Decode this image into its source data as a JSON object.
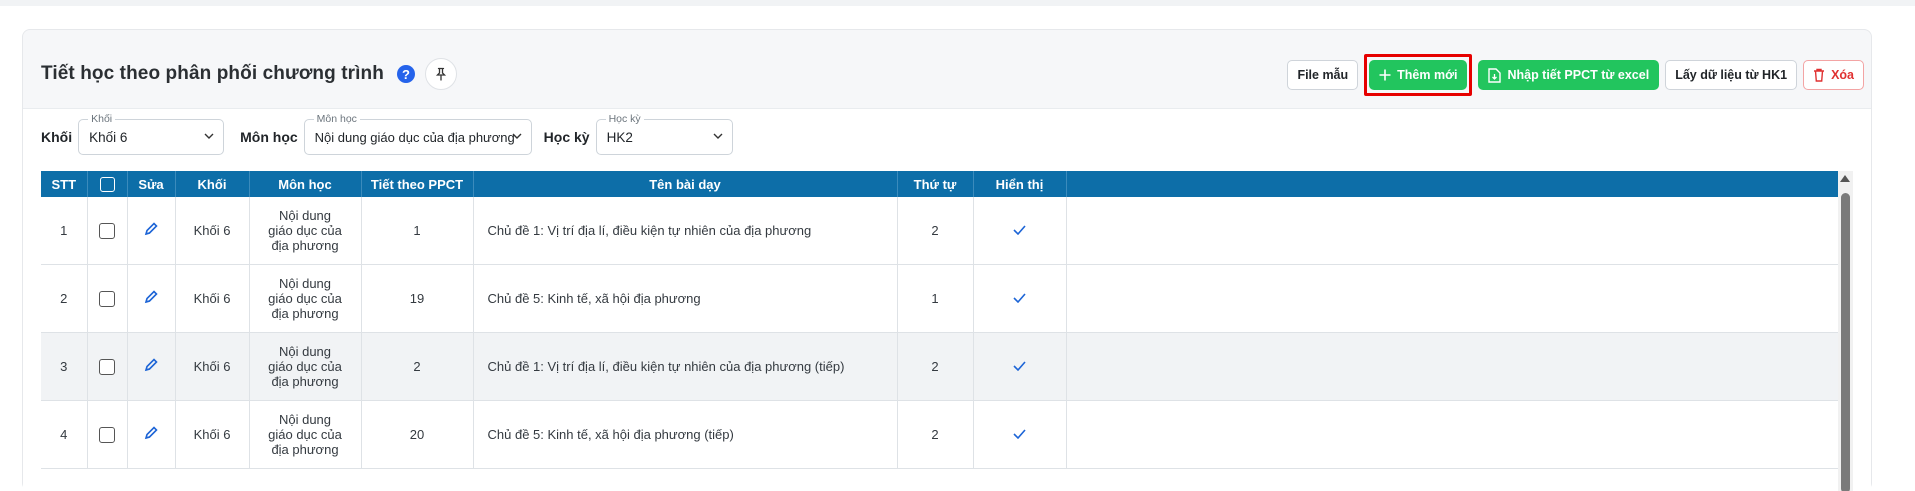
{
  "header": {
    "title": "Tiết học theo phân phối chương trình",
    "help_glyph": "?"
  },
  "toolbar": {
    "sample_file": "File mẫu",
    "add_new": "Thêm mới",
    "import_excel": "Nhập tiết PPCT từ excel",
    "get_hk1": "Lấy dữ liệu từ HK1",
    "delete": "Xóa"
  },
  "filters": {
    "grade": {
      "label": "Khối",
      "legend": "Khối",
      "value": "Khối 6"
    },
    "subject": {
      "label": "Môn học",
      "legend": "Môn học",
      "value": "Nội dung giáo dục của địa phương"
    },
    "semester": {
      "label": "Học kỳ",
      "legend": "Học kỳ",
      "value": "HK2"
    }
  },
  "table": {
    "columns": [
      "STT",
      "",
      "Sửa",
      "Khối",
      "Môn học",
      "Tiết theo PPCT",
      "Tên bài dạy",
      "Thứ tự",
      "Hiển thị",
      ""
    ],
    "rows": [
      {
        "stt": "1",
        "grade": "Khối 6",
        "subject_l1": "Nội dung",
        "subject_l2": "giáo dục của",
        "subject_l3": "địa phương",
        "period": "1",
        "lesson": "Chủ đề 1: Vị trí địa lí, điều kiện tự nhiên của địa phương",
        "order": "2",
        "visible": true
      },
      {
        "stt": "2",
        "grade": "Khối 6",
        "subject_l1": "Nội dung",
        "subject_l2": "giáo dục của",
        "subject_l3": "địa phương",
        "period": "19",
        "lesson": "Chủ đề 5: Kinh tế, xã hội địa phương",
        "order": "1",
        "visible": true
      },
      {
        "stt": "3",
        "grade": "Khối 6",
        "subject_l1": "Nội dung",
        "subject_l2": "giáo dục của",
        "subject_l3": "địa phương",
        "period": "2",
        "lesson": "Chủ đề 1: Vị trí địa lí, điều kiện tự nhiên của địa phương (tiếp)",
        "order": "2",
        "visible": true
      },
      {
        "stt": "4",
        "grade": "Khối 6",
        "subject_l1": "Nội dung",
        "subject_l2": "giáo dục của",
        "subject_l3": "địa phương",
        "period": "20",
        "lesson": "Chủ đề 5: Kinh tế, xã hội địa phương (tiếp)",
        "order": "2",
        "visible": true
      }
    ]
  },
  "colors": {
    "header_blue": "#0d6ea8",
    "green": "#22c55e",
    "highlight_red": "#e60000",
    "danger": "#e03131",
    "edit_blue": "#1c64d6"
  }
}
